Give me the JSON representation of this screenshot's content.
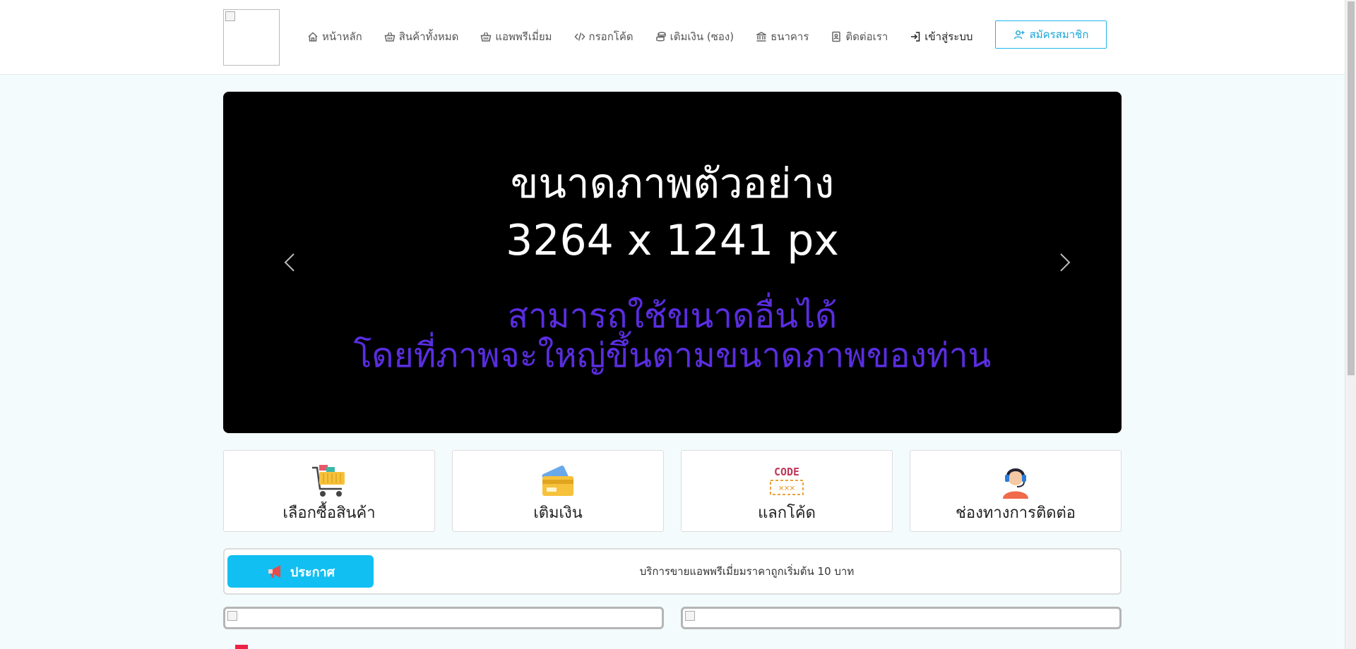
{
  "nav": {
    "items": [
      {
        "label": "หน้าหลัก",
        "icon": "home-icon"
      },
      {
        "label": "สินค้าทั้งหมด",
        "icon": "basket-icon"
      },
      {
        "label": "แอพพรีเมี่ยม",
        "icon": "basket-icon"
      },
      {
        "label": "กรอกโค้ด",
        "icon": "code-icon"
      },
      {
        "label": "เติมเงิน (ซอง)",
        "icon": "coins-icon"
      },
      {
        "label": "ธนาคาร",
        "icon": "bank-icon"
      },
      {
        "label": "ติดต่อเรา",
        "icon": "contact-book-icon"
      },
      {
        "label": "เข้าสู่ระบบ",
        "icon": "login-icon"
      }
    ],
    "register_label": "สมัครสมาชิก"
  },
  "carousel": {
    "line1": "ขนาดภาพตัวอย่าง",
    "line2": "3264 x 1241 px",
    "line3": "สามารถใช้ขนาดอื่นได้",
    "line4": "โดยที่ภาพจะใหญ่ขึ้นตามขนาดภาพของท่าน",
    "accent_color": "#5a2de0"
  },
  "cards": [
    {
      "label": "เลือกซื้อสินค้า",
      "icon": "shopping-cart-icon"
    },
    {
      "label": "เติมเงิน",
      "icon": "credit-card-icon"
    },
    {
      "label": "แลกโค้ด",
      "icon": "code-coupon-icon"
    },
    {
      "label": "ช่องทางการติดต่อ",
      "icon": "support-agent-icon"
    }
  ],
  "announcement": {
    "button_label": "ประกาศ",
    "text": "บริการขายแอพพรีเมี่ยมราคาถูกเริ่มต้น 10 บาท",
    "accent_color": "#12bff2"
  },
  "colors": {
    "brand": "#1fb7e8",
    "page_bg": "#f3fbfd"
  }
}
